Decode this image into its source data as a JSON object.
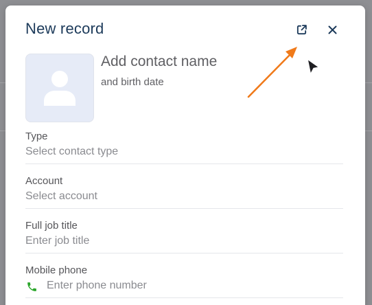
{
  "modal": {
    "title": "New record",
    "open_in_new_icon": "open-in-new-icon",
    "close_icon": "close-icon"
  },
  "contact": {
    "name_placeholder": "Add contact name",
    "birth_date_placeholder": "and birth date",
    "avatar_icon": "person-icon"
  },
  "fields": [
    {
      "label": "Type",
      "placeholder": "Select contact type"
    },
    {
      "label": "Account",
      "placeholder": "Select account"
    },
    {
      "label": "Full job title",
      "placeholder": "Enter job title"
    },
    {
      "label": "Mobile phone",
      "placeholder": "Enter phone number",
      "icon": "phone-icon"
    }
  ],
  "colors": {
    "title": "#1c3a5a",
    "annotation_arrow": "#f07a1a",
    "phone_icon": "#2aa62a",
    "avatar_bg": "#e6ebf7"
  }
}
